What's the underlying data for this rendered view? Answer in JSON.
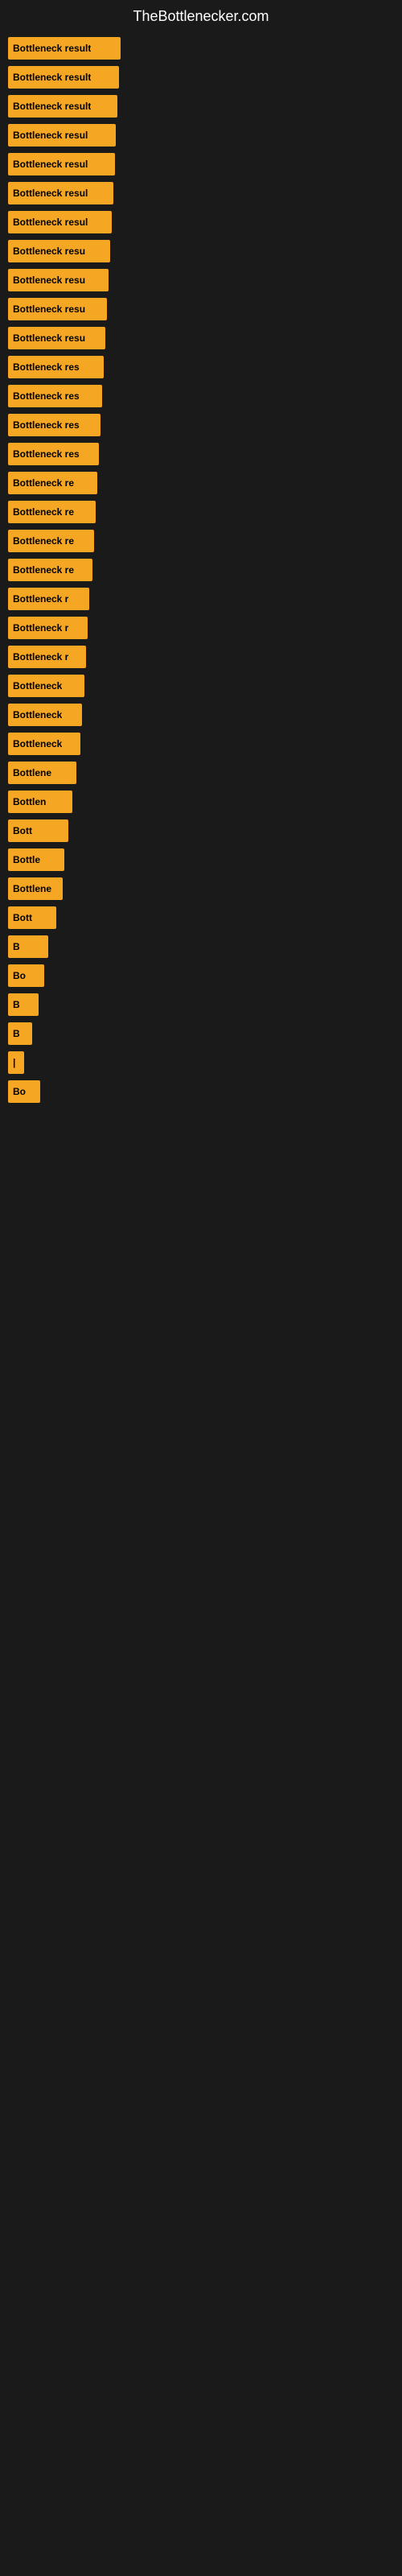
{
  "site": {
    "title": "TheBottlenecker.com"
  },
  "bars": [
    {
      "label": "Bottleneck result",
      "width": 140
    },
    {
      "label": "Bottleneck result",
      "width": 138
    },
    {
      "label": "Bottleneck result",
      "width": 136
    },
    {
      "label": "Bottleneck result",
      "width": 134
    },
    {
      "label": "Bottleneck result",
      "width": 133
    },
    {
      "label": "Bottleneck result",
      "width": 131
    },
    {
      "label": "Bottleneck result",
      "width": 129
    },
    {
      "label": "Bottleneck result",
      "width": 127
    },
    {
      "label": "Bottleneck result",
      "width": 125
    },
    {
      "label": "Bottleneck result",
      "width": 123
    },
    {
      "label": "Bottleneck result",
      "width": 121
    },
    {
      "label": "Bottleneck result",
      "width": 119
    },
    {
      "label": "Bottleneck result",
      "width": 117
    },
    {
      "label": "Bottleneck result",
      "width": 115
    },
    {
      "label": "Bottleneck result",
      "width": 113
    },
    {
      "label": "Bottleneck result",
      "width": 111
    },
    {
      "label": "Bottleneck result",
      "width": 109
    },
    {
      "label": "Bottleneck result",
      "width": 107
    },
    {
      "label": "Bottleneck resu",
      "width": 105
    },
    {
      "label": "Bottleneck re",
      "width": 101
    },
    {
      "label": "Bottleneck resu",
      "width": 99
    },
    {
      "label": "Bottleneck res",
      "width": 97
    },
    {
      "label": "Bottleneck result",
      "width": 95
    },
    {
      "label": "Bottleneck r",
      "width": 92
    },
    {
      "label": "Bottleneck resu",
      "width": 90
    },
    {
      "label": "Bottlene",
      "width": 85
    },
    {
      "label": "Bottlen",
      "width": 80
    },
    {
      "label": "Bott",
      "width": 75
    },
    {
      "label": "Bottle",
      "width": 70
    },
    {
      "label": "Bottlenec",
      "width": 68
    },
    {
      "label": "Bott",
      "width": 60
    },
    {
      "label": "B",
      "width": 50
    },
    {
      "label": "Bo",
      "width": 45
    },
    {
      "label": "B",
      "width": 38
    },
    {
      "label": "B",
      "width": 30
    },
    {
      "label": "|",
      "width": 20
    },
    {
      "label": "Bo",
      "width": 40
    }
  ]
}
